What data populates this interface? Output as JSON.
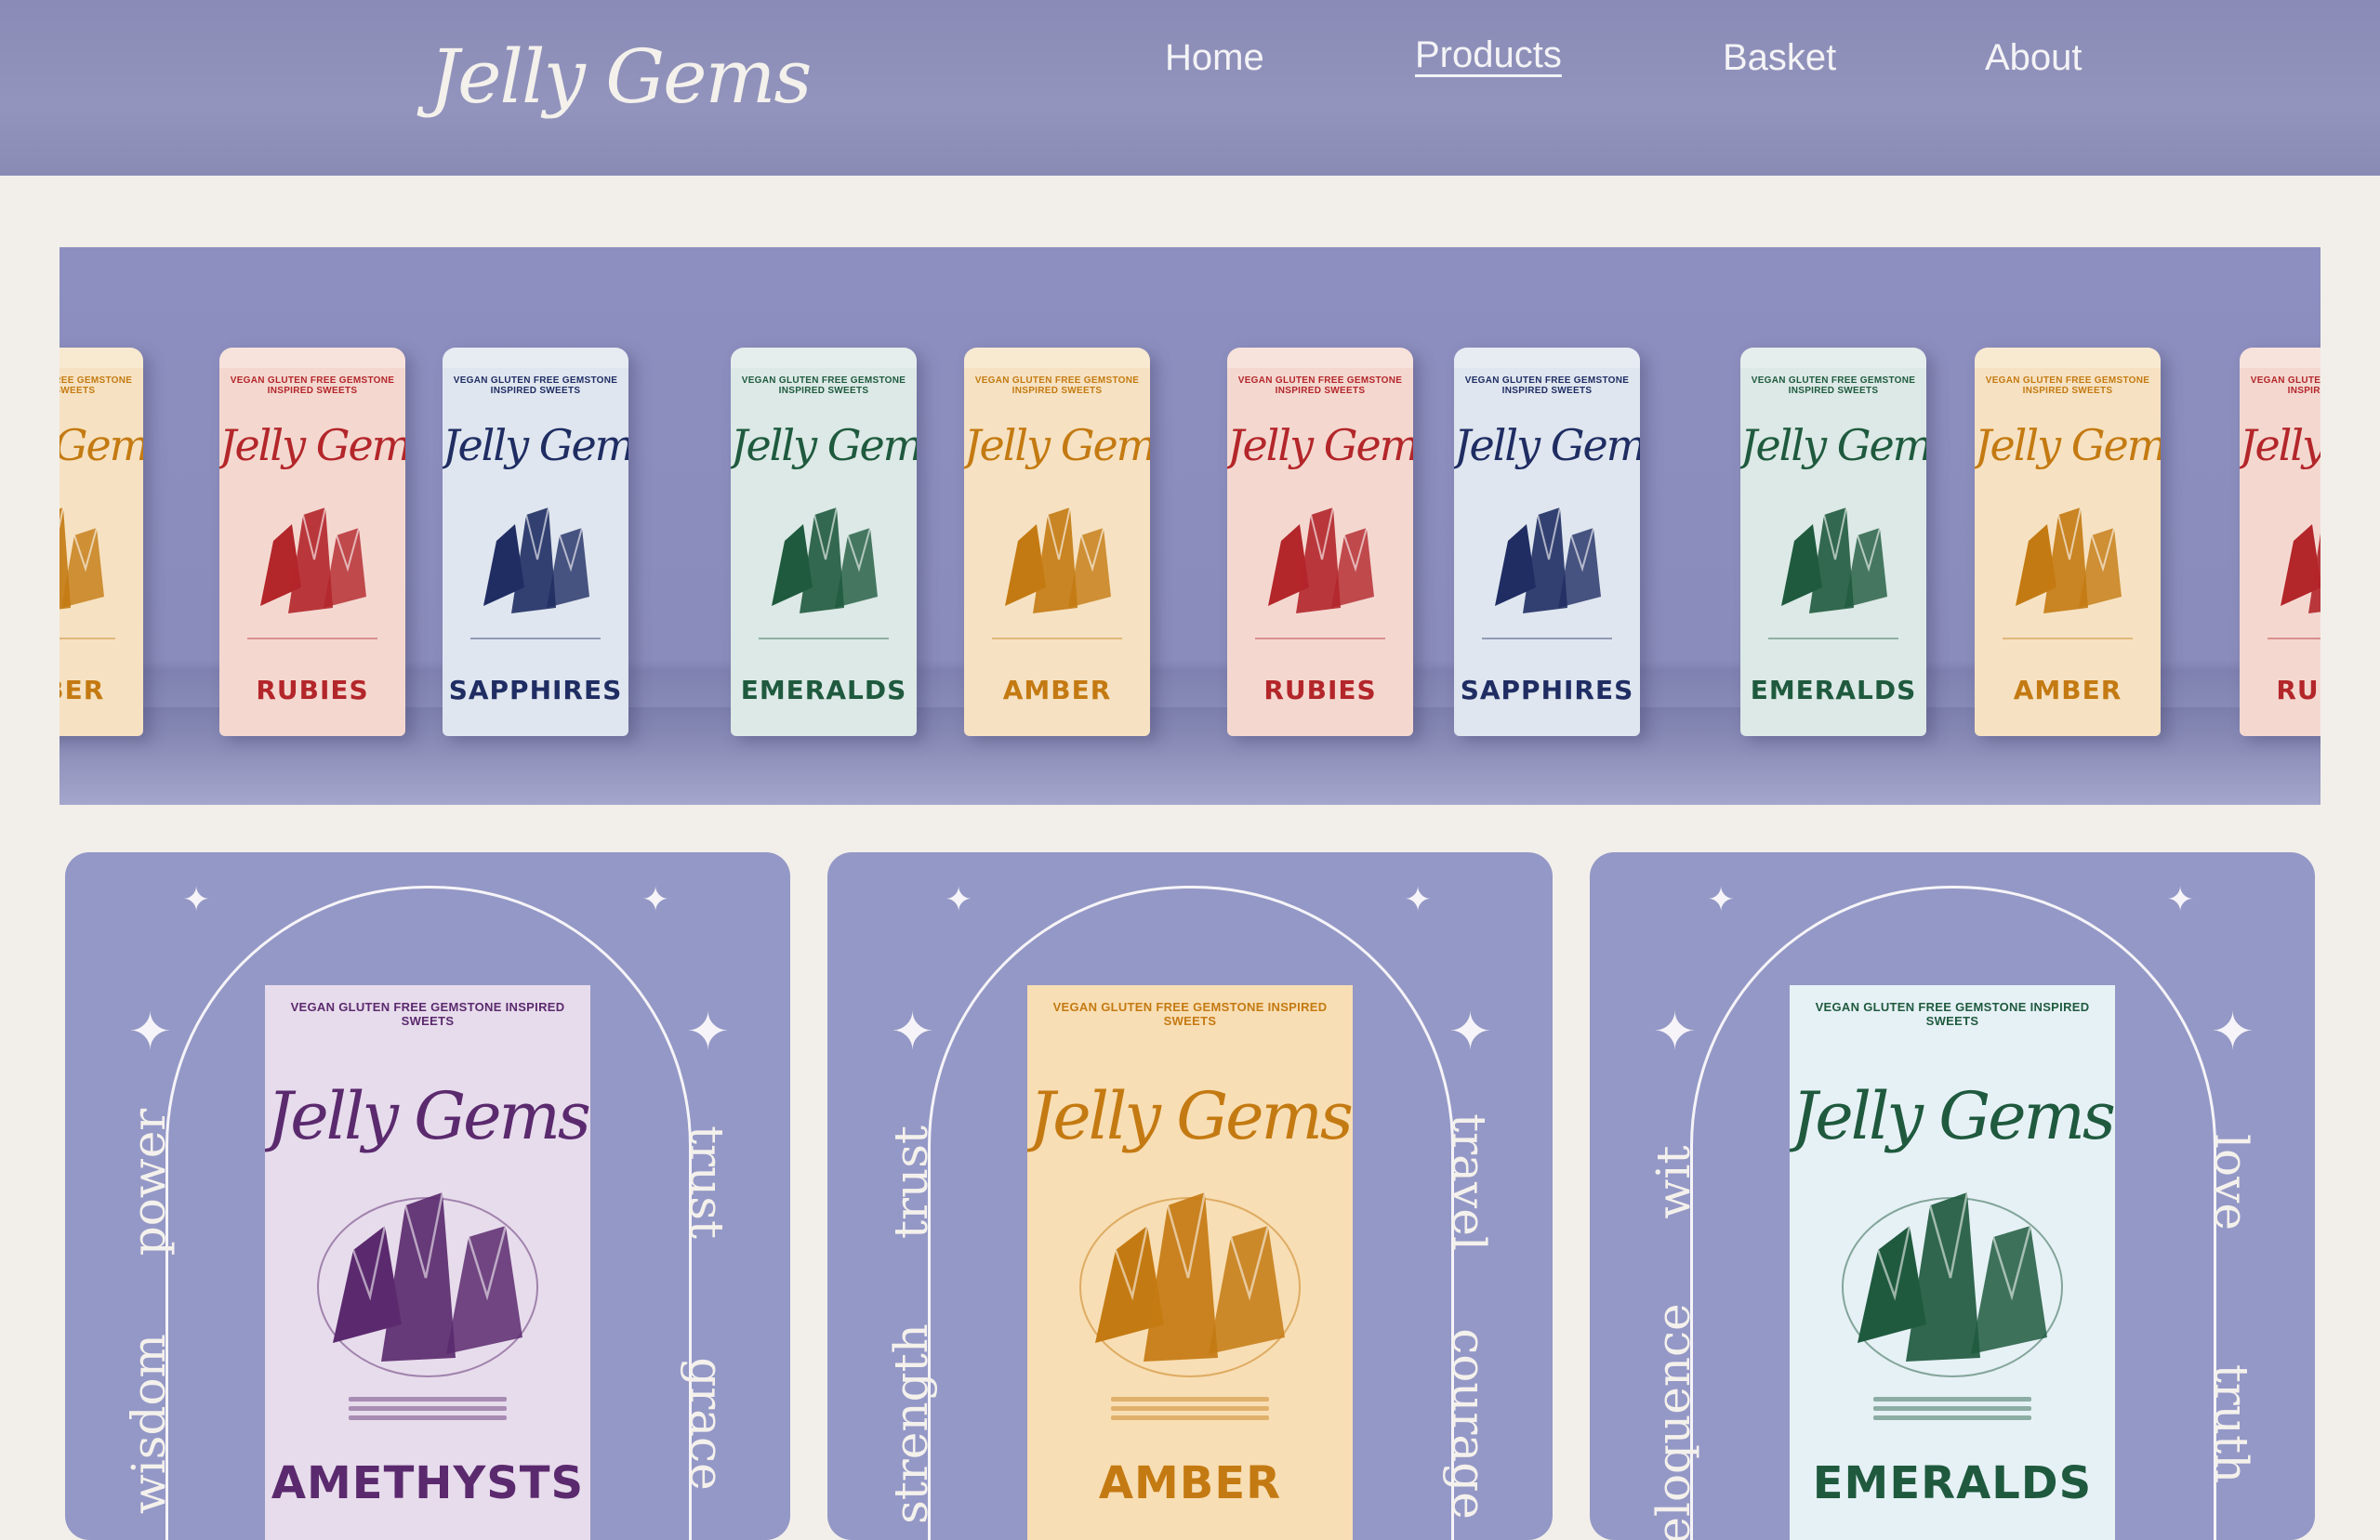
{
  "header": {
    "logo": "Jelly Gems",
    "nav": [
      {
        "label": "Home",
        "active": false
      },
      {
        "label": "Products",
        "active": true
      },
      {
        "label": "Basket",
        "active": false
      },
      {
        "label": "About",
        "active": false
      }
    ]
  },
  "hero": {
    "pouches": [
      {
        "brand": "Jelly Gems",
        "tag": "VEGAN GLUTEN FREE GEMSTONE INSPIRED SWEETS",
        "name": "AMBER",
        "color": "#c47a12",
        "bg": "#f6e2c2"
      },
      {
        "brand": "Jelly Gems",
        "tag": "VEGAN GLUTEN FREE GEMSTONE INSPIRED SWEETS",
        "name": "RUBIES",
        "color": "#b3262a",
        "bg": "#f4d8d0"
      },
      {
        "brand": "Jelly Gems",
        "tag": "VEGAN GLUTEN FREE GEMSTONE INSPIRED SWEETS",
        "name": "SAPPHIRES",
        "color": "#1f2d63",
        "bg": "#dfe6ef"
      },
      {
        "brand": "Jelly Gems",
        "tag": "VEGAN GLUTEN FREE GEMSTONE INSPIRED SWEETS",
        "name": "EMERALDS",
        "color": "#1f5a3e",
        "bg": "#dce9e6"
      },
      {
        "brand": "Jelly Gems",
        "tag": "VEGAN GLUTEN FREE GEMSTONE INSPIRED SWEETS",
        "name": "AMBER",
        "color": "#c47a12",
        "bg": "#f6e2c2"
      },
      {
        "brand": "Jelly Gems",
        "tag": "VEGAN GLUTEN FREE GEMSTONE INSPIRED SWEETS",
        "name": "RUBIES",
        "color": "#b3262a",
        "bg": "#f4d8d0"
      },
      {
        "brand": "Jelly Gems",
        "tag": "VEGAN GLUTEN FREE GEMSTONE INSPIRED SWEETS",
        "name": "SAPPHIRES",
        "color": "#1f2d63",
        "bg": "#dfe6ef"
      },
      {
        "brand": "Jelly Gems",
        "tag": "VEGAN GLUTEN FREE GEMSTONE INSPIRED SWEETS",
        "name": "EMERALDS",
        "color": "#1f5a3e",
        "bg": "#dce9e6"
      },
      {
        "brand": "Jelly Gems",
        "tag": "VEGAN GLUTEN FREE GEMSTONE INSPIRED SWEETS",
        "name": "AMBER",
        "color": "#c47a12",
        "bg": "#f6e2c2"
      },
      {
        "brand": "Jelly Gems",
        "tag": "VEGAN GLUTEN FREE GEMSTONE INSPIRED SWEETS",
        "name": "RUBIES",
        "color": "#b3262a",
        "bg": "#f4d8d0"
      }
    ]
  },
  "products": [
    {
      "brand": "Jelly Gems",
      "tag": "VEGAN GLUTEN FREE GEMSTONE INSPIRED SWEETS",
      "name": "AMETHYSTS",
      "color": "#5b2a6e",
      "bg": "#e7dcec",
      "words": {
        "left_top": "power",
        "left_bottom": "wisdom",
        "right_top": "trust",
        "right_bottom": "grace"
      }
    },
    {
      "brand": "Jelly Gems",
      "tag": "VEGAN GLUTEN FREE GEMSTONE INSPIRED SWEETS",
      "name": "AMBER",
      "color": "#c47a12",
      "bg": "#f8deb4",
      "words": {
        "left_top": "trust",
        "left_bottom": "strength",
        "right_top": "travel",
        "right_bottom": "courage"
      }
    },
    {
      "brand": "Jelly Gems",
      "tag": "VEGAN GLUTEN FREE GEMSTONE INSPIRED SWEETS",
      "name": "EMERALDS",
      "color": "#1f5a3e",
      "bg": "#e6f1f6",
      "words": {
        "left_top": "wit",
        "left_bottom": "eloquence",
        "right_top": "love",
        "right_bottom": "truth"
      }
    }
  ]
}
